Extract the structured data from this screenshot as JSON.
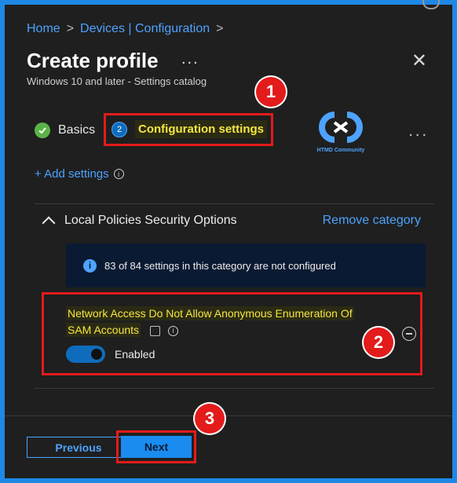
{
  "breadcrumb": {
    "home": "Home",
    "devices": "Devices | Configuration",
    "separator": ">"
  },
  "header": {
    "title": "Create profile",
    "more": "...",
    "subtitle": "Windows 10 and later - Settings catalog",
    "close": "✕"
  },
  "badges": {
    "one": "1",
    "two": "2",
    "three": "3"
  },
  "steps": {
    "basics": "Basics",
    "config_number": "2",
    "config": "Configuration settings",
    "more": "...",
    "logo_text": "HTMD Community"
  },
  "add_settings": "+ Add settings",
  "category": {
    "name": "Local Policies Security Options",
    "remove": "Remove category",
    "info": "83 of 84 settings in this category are not configured"
  },
  "setting": {
    "name_line1": "Network Access Do Not Allow Anonymous Enumeration Of",
    "name_line2": "SAM Accounts",
    "toggle_label": "Enabled",
    "toggle_on": true
  },
  "footer": {
    "previous": "Previous",
    "next": "Next"
  },
  "colors": {
    "accent": "#4da3ff",
    "annotation": "#e31b1b",
    "highlight": "#f5e642"
  },
  "icons": [
    "check-icon",
    "info-icon",
    "chevron-up-icon",
    "close-icon",
    "more-icon",
    "remove-icon",
    "duplicate-icon",
    "info-outline-icon"
  ]
}
